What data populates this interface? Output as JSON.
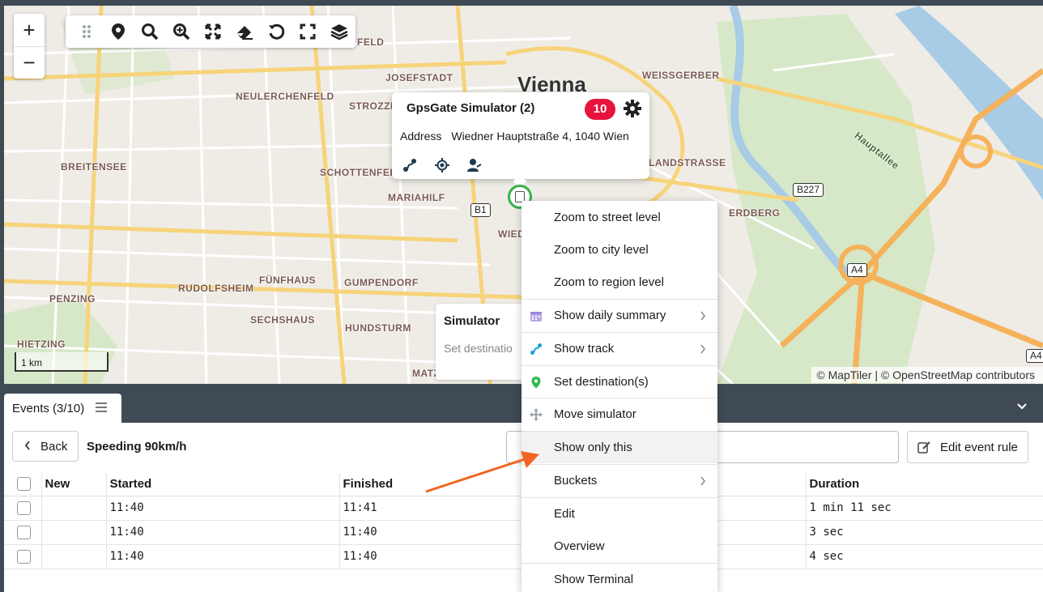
{
  "map": {
    "city": "Vienna",
    "districts": [
      "JOSEFSTADT",
      "NEULERCHENFELD",
      "STROZZI",
      "WEISSGERBER",
      "BREITENSEE",
      "SCHOTTENFELD",
      "MARIAHILF",
      "LANDSTRASSE",
      "ERDBERG",
      "RUDOLFSHEIM",
      "FÜNFHAUS",
      "GUMPENDORF",
      "PENZING",
      "SECHSHAUS",
      "HUNDSTURM",
      "HIETZING",
      "MATZ",
      "WIED",
      "FELD"
    ],
    "park_label": "Hauptallee",
    "road_shields": [
      "B1",
      "B227",
      "A4",
      "A4"
    ],
    "scale_label": "1 km",
    "attribution": "© MapTiler | © OpenStreetMap contributors",
    "zoom_in": "+",
    "zoom_out": "−",
    "toolbar_icons": [
      "drag-handle-icon",
      "location-pin-icon",
      "search-icon",
      "zoom-in-icon",
      "fit-extent-icon",
      "eraser-icon",
      "refresh-icon",
      "fullscreen-icon",
      "layers-icon"
    ],
    "popup": {
      "title": "GpsGate Simulator (2)",
      "badge": "10",
      "address_label": "Address",
      "address_value": "Wiedner Hauptstraße 4, 1040 Wien"
    },
    "sim_card": {
      "title": "Simulator",
      "subtitle": "Set destinatio"
    }
  },
  "context_menu": {
    "items": [
      {
        "label": "Zoom to street level"
      },
      {
        "label": "Zoom to city level"
      },
      {
        "label": "Zoom to region level"
      },
      {
        "label": "Show daily summary",
        "icon": "calendar-icon",
        "submenu": true
      },
      {
        "label": "Show track",
        "icon": "track-icon",
        "submenu": true
      },
      {
        "label": "Set destination(s)",
        "icon": "pin-icon"
      },
      {
        "label": "Move simulator",
        "icon": "move-icon"
      },
      {
        "label": "Show only this"
      },
      {
        "label": "Buckets",
        "submenu": true
      },
      {
        "label": "Edit"
      },
      {
        "label": "Overview"
      },
      {
        "label": "Show Terminal"
      }
    ]
  },
  "events": {
    "tab_label": "Events (3/10)",
    "back_label": "Back",
    "title": "Speeding 90km/h",
    "edit_rule_label": "Edit event rule",
    "columns": [
      "New",
      "Started",
      "Finished",
      "Duration"
    ],
    "rows": [
      {
        "started": "11:40",
        "finished": "11:41",
        "duration": "1 min 11 sec"
      },
      {
        "started": "11:40",
        "finished": "11:40",
        "duration": "3 sec"
      },
      {
        "started": "11:40",
        "finished": "11:40",
        "duration": "4 sec"
      }
    ]
  },
  "colors": {
    "accent_red": "#e6143c",
    "marker_green": "#35b34a",
    "annotation_arrow": "#f26522",
    "road_yellow": "#f7d37a",
    "highway_orange": "#f5b25a",
    "river_blue": "#a8cbe6",
    "park_green": "#d6e8c8"
  }
}
